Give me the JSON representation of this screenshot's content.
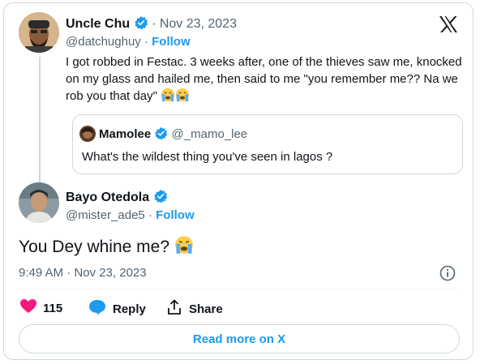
{
  "tweet1": {
    "name": "Uncle Chu",
    "date": "Nov 23, 2023",
    "handle": "@datchughuy",
    "follow": "Follow",
    "separator": "·",
    "text": "I got robbed in Festac. 3 weeks after, one of the thieves saw me, knocked on my glass and hailed me, then said to me \"you remember me?? Na we rob you that day\""
  },
  "quote": {
    "name": "Mamolee",
    "handle": "@_mamo_lee",
    "text": "What's the wildest thing you've seen in lagos ?"
  },
  "tweet2": {
    "name": "Bayo Otedola",
    "handle": "@mister_ade5",
    "follow": "Follow",
    "separator": "·",
    "text": "You Dey whine me?",
    "timestamp": "9:49 AM · Nov 23, 2023"
  },
  "actions": {
    "likes": "115",
    "reply": "Reply",
    "share": "Share"
  },
  "read_more": "Read more on X",
  "colors": {
    "accent": "#1d9bf0",
    "like": "#f91880",
    "text": "#0f1419",
    "muted": "#536471",
    "border": "#cfd9de"
  },
  "icons": [
    "verified-badge-icon",
    "x-logo-icon",
    "crying-face-emoji",
    "heart-icon",
    "reply-bubble-icon",
    "share-icon",
    "info-icon"
  ]
}
